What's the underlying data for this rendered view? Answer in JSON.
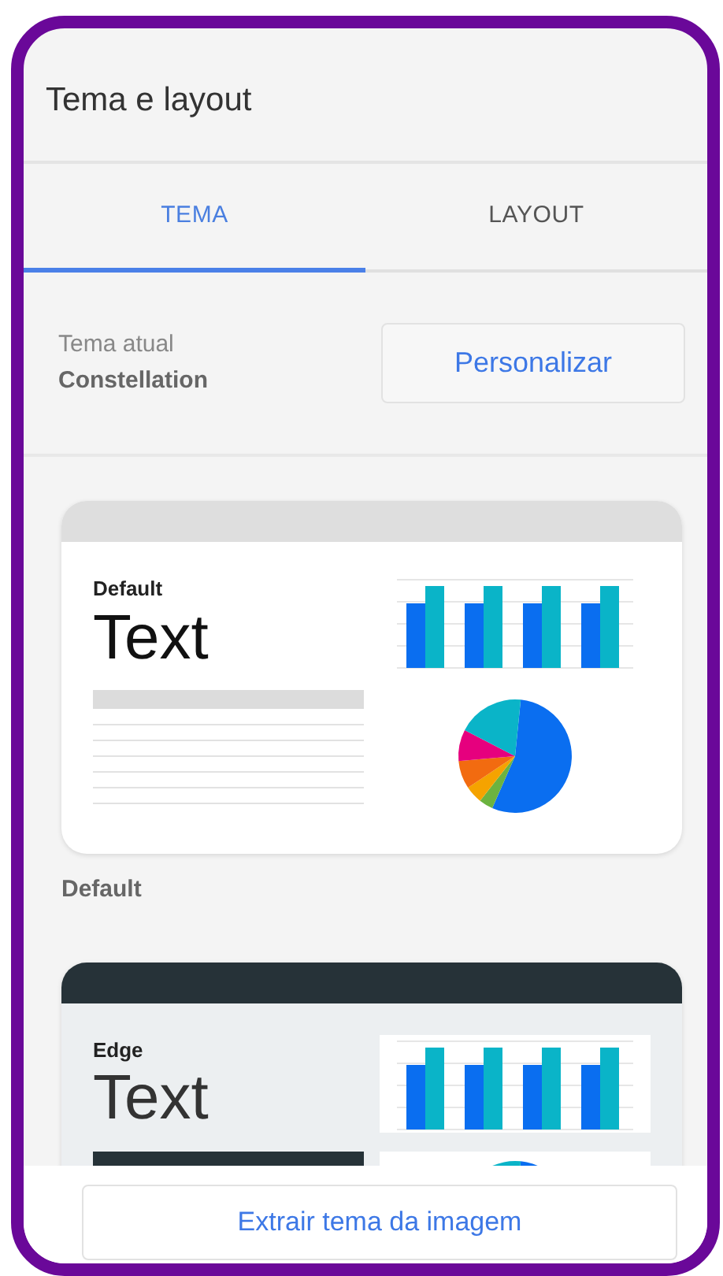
{
  "panel": {
    "title": "Tema e layout"
  },
  "tabs": [
    {
      "label": "TEMA",
      "selected": true
    },
    {
      "label": "LAYOUT",
      "selected": false
    }
  ],
  "current_theme": {
    "label": "Tema atual",
    "name": "Constellation",
    "button": "Personalizar"
  },
  "themes": [
    {
      "kind": "light",
      "heading": "Default",
      "sample": "Text",
      "name": "Default"
    },
    {
      "kind": "dark",
      "heading": "Edge",
      "sample": "Text"
    }
  ],
  "footer_button": "Extrair tema da imagem"
}
